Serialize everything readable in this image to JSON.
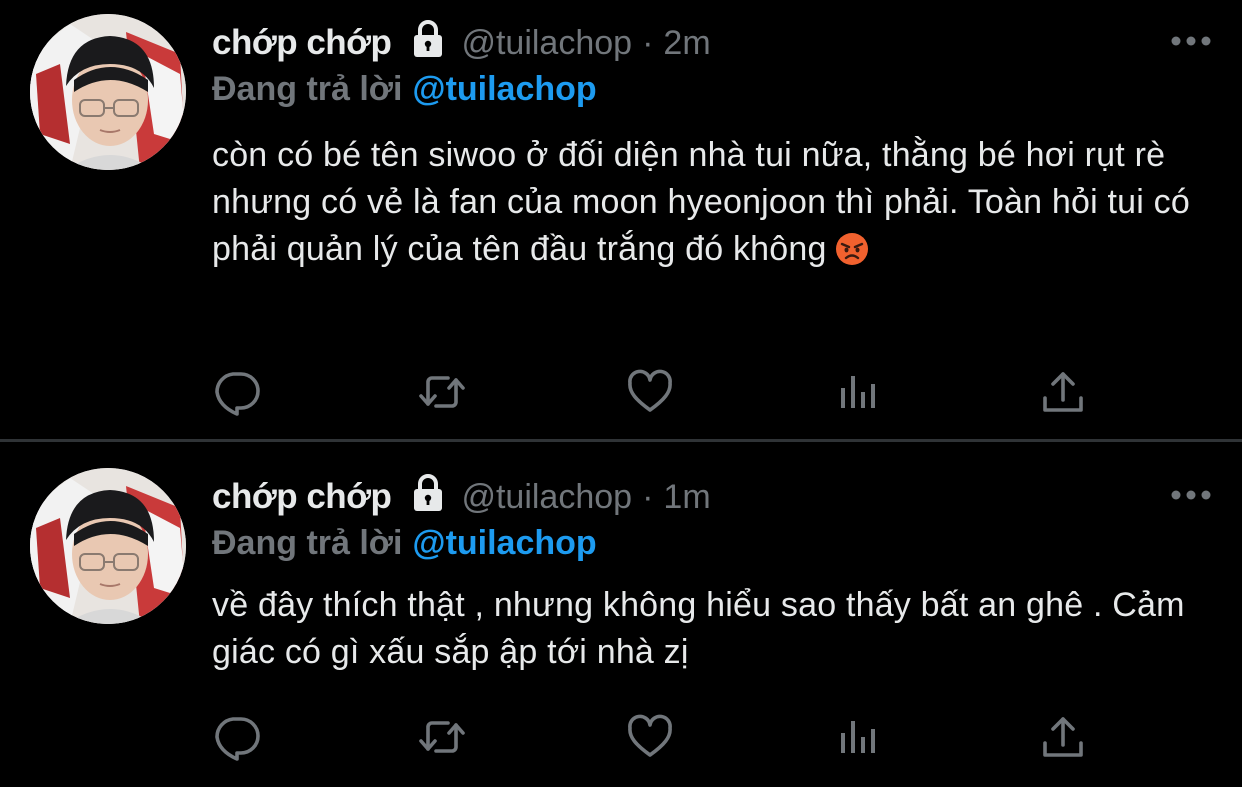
{
  "tweets": [
    {
      "display_name": "chớp chớp",
      "handle": "@tuilachop",
      "separator": "·",
      "time": "2m",
      "reply_prefix": "Đang trả lời",
      "reply_to": "@tuilachop",
      "text": "còn có bé tên siwoo ở đối diện nhà tui nữa, thằng bé hơi rụt rè nhưng có vẻ là fan của moon hyeonjoon thì phải. Toàn hỏi tui có phải quản lý của tên đầu trắng đó không",
      "emoji": "pouting-face-emoji"
    },
    {
      "display_name": "chớp chớp",
      "handle": "@tuilachop",
      "separator": "·",
      "time": "1m",
      "reply_prefix": "Đang trả lời",
      "reply_to": "@tuilachop",
      "text": "về đây thích thật , nhưng không hiểu sao thấy bất an ghê . Cảm giác có gì xấu sắp ập tới nhà zị"
    }
  ],
  "icons": {
    "lock": "lock-icon",
    "more": "more-icon",
    "reply": "reply-icon",
    "retweet": "retweet-icon",
    "like": "heart-icon",
    "views": "views-icon",
    "share": "share-icon"
  },
  "colors": {
    "background": "#000000",
    "primary_text": "#e7e9ea",
    "secondary_text": "#71767b",
    "accent": "#1d9bf0",
    "divider": "#2f3336"
  }
}
